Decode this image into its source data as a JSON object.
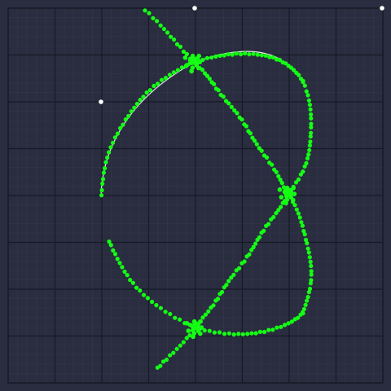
{
  "colors": {
    "background": "#2a2d3f",
    "grid_minor": "#34374b",
    "grid_major": "#161a26",
    "curve": "#e6e6ee",
    "dots": "#14ff14",
    "control_point": "#ffffff"
  },
  "icons": {
    "control_point": "control-point-icon",
    "dot": "green-dot-icon"
  }
}
